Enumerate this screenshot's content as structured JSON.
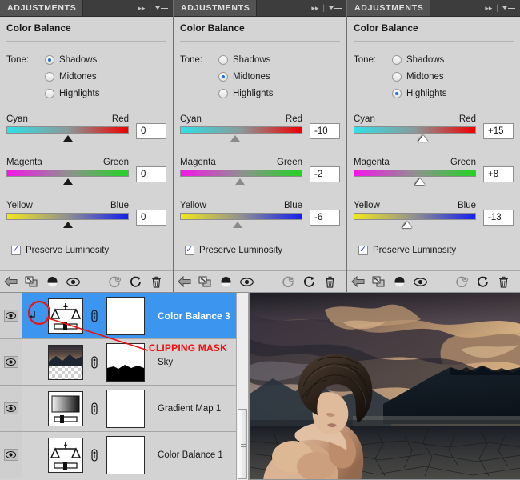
{
  "panels": [
    {
      "tab_label": "ADJUSTMENTS",
      "title": "Color Balance",
      "tone_label": "Tone:",
      "tone_options": [
        {
          "label": "Shadows",
          "selected": true
        },
        {
          "label": "Midtones",
          "selected": false
        },
        {
          "label": "Highlights",
          "selected": false
        }
      ],
      "sliders": [
        {
          "left_label": "Cyan",
          "right_label": "Red",
          "value": "0",
          "position_pct": 50
        },
        {
          "left_label": "Magenta",
          "right_label": "Green",
          "value": "0",
          "position_pct": 50
        },
        {
          "left_label": "Yellow",
          "right_label": "Blue",
          "value": "0",
          "position_pct": 50
        }
      ],
      "preserve_luminosity": {
        "label": "Preserve Luminosity",
        "checked": true
      },
      "thumb_style": "black"
    },
    {
      "tab_label": "ADJUSTMENTS",
      "title": "Color Balance",
      "tone_label": "Tone:",
      "tone_options": [
        {
          "label": "Shadows",
          "selected": false
        },
        {
          "label": "Midtones",
          "selected": true
        },
        {
          "label": "Highlights",
          "selected": false
        }
      ],
      "sliders": [
        {
          "left_label": "Cyan",
          "right_label": "Red",
          "value": "-10",
          "position_pct": 45
        },
        {
          "left_label": "Magenta",
          "right_label": "Green",
          "value": "-2",
          "position_pct": 49
        },
        {
          "left_label": "Yellow",
          "right_label": "Blue",
          "value": "-6",
          "position_pct": 47
        }
      ],
      "preserve_luminosity": {
        "label": "Preserve Luminosity",
        "checked": true
      },
      "thumb_style": "gray"
    },
    {
      "tab_label": "ADJUSTMENTS",
      "title": "Color Balance",
      "tone_label": "Tone:",
      "tone_options": [
        {
          "label": "Shadows",
          "selected": false
        },
        {
          "label": "Midtones",
          "selected": false
        },
        {
          "label": "Highlights",
          "selected": true
        }
      ],
      "sliders": [
        {
          "left_label": "Cyan",
          "right_label": "Red",
          "value": "+15",
          "position_pct": 57
        },
        {
          "left_label": "Magenta",
          "right_label": "Green",
          "value": "+8",
          "position_pct": 54
        },
        {
          "left_label": "Yellow",
          "right_label": "Blue",
          "value": "-13",
          "position_pct": 44
        }
      ],
      "preserve_luminosity": {
        "label": "Preserve Luminosity",
        "checked": true
      },
      "thumb_style": "white"
    }
  ],
  "panel_toolbar": {
    "icons": [
      "return-to-adjustment-list-icon",
      "clip-to-layer-icon",
      "toggle-layer-visibility-icon",
      "preview-eye-icon",
      "reset-to-previous-icon",
      "reset-adjustment-icon",
      "delete-adjustment-icon"
    ]
  },
  "header_buttons": {
    "collapse_icon": "double-arrow-right-icon",
    "menu_icon": "panel-menu-icon"
  },
  "layers": [
    {
      "name": "Color Balance 3",
      "visible": true,
      "selected": true,
      "clipped": true,
      "thumb_type": "color-balance-adjustment-thumbnail",
      "mask_type": "white-mask"
    },
    {
      "name": "Sky",
      "visible": true,
      "selected": false,
      "clipped": false,
      "underlined": true,
      "thumb_type": "sky-photo-thumbnail",
      "mask_type": "split-mask"
    },
    {
      "name": "Gradient Map 1",
      "visible": true,
      "selected": false,
      "clipped": false,
      "thumb_type": "gradient-map-adjustment-thumbnail",
      "mask_type": "white-mask"
    },
    {
      "name": "Color Balance 1",
      "visible": true,
      "selected": false,
      "clipped": false,
      "thumb_type": "color-balance-adjustment-thumbnail",
      "mask_type": "white-mask"
    }
  ],
  "annotations": {
    "clipping_mask_label": "CLIPPING MASK",
    "highlight_color": "#ee1111"
  },
  "colors": {
    "panel_bg": "#d4d4d4",
    "header_bg": "#3d3d3d",
    "tab_bg": "#535353",
    "selection_blue": "#3c96f0",
    "annotation_red": "#ee1111"
  },
  "photo": {
    "description": "composited-portrait-on-stormy-landscape"
  }
}
